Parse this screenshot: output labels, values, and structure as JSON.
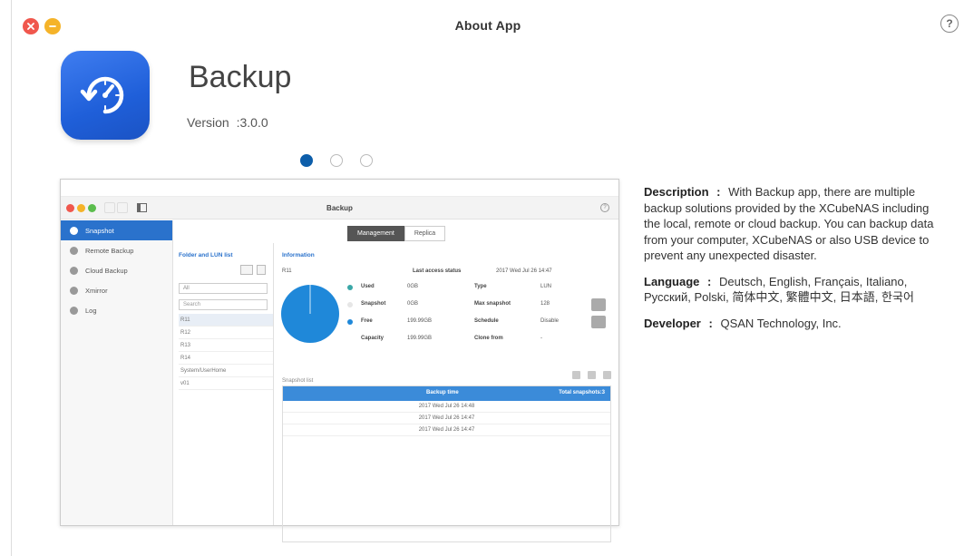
{
  "window": {
    "title": "About App",
    "help_symbol": "?"
  },
  "app": {
    "name": "Backup",
    "version_label": "Version",
    "version_sep": ":",
    "version": "3.0.0",
    "icon": "backup-restore-icon"
  },
  "pager": {
    "count": 3,
    "active_index": 0
  },
  "preview": {
    "title": "Backup",
    "sidebar": [
      {
        "label": "Snapshot",
        "active": true
      },
      {
        "label": "Remote Backup",
        "active": false
      },
      {
        "label": "Cloud Backup",
        "active": false
      },
      {
        "label": "Xmirror",
        "active": false
      },
      {
        "label": "Log",
        "active": false
      }
    ],
    "tabs": [
      {
        "label": "Management",
        "active": true
      },
      {
        "label": "Replica",
        "active": false
      }
    ],
    "lun_panel": {
      "header": "Folder and LUN list",
      "filter": "All",
      "search_placeholder": "Search",
      "items": [
        "R11",
        "R12",
        "R13",
        "R14",
        "System/UserHome",
        "v01"
      ]
    },
    "info": {
      "header": "Information",
      "name": "R11",
      "last_access_label": "Last access status",
      "last_access_value": "2017 Wed Jul 26 14:47",
      "rows": [
        {
          "label": "Used",
          "value": "0GB",
          "key": "Type",
          "kvalue": "LUN"
        },
        {
          "label": "Snapshot",
          "value": "0GB",
          "key": "Max snapshot",
          "kvalue": "128"
        },
        {
          "label": "Free",
          "value": "199.99GB",
          "key": "Schedule",
          "kvalue": "Disable"
        },
        {
          "label": "Capacity",
          "value": "199.99GB",
          "key": "Clone from",
          "kvalue": "-"
        }
      ],
      "chart_colors": {
        "used": "#3aa7a7",
        "snapshot": "#e6e6e6",
        "free": "#1f88d9"
      }
    },
    "snapshots": {
      "label": "Snapshot list",
      "col_time": "Backup time",
      "col_total": "Total snapshots:3",
      "rows": [
        "2017 Wed Jul 26 14:48",
        "2017 Wed Jul 26 14:47",
        "2017 Wed Jul 26 14:47"
      ]
    }
  },
  "details": {
    "description_label": "Description",
    "description": "With Backup app, there are multiple backup solutions provided by the XCubeNAS including the local, remote or cloud backup. You can backup data from your computer, XCubeNAS or also USB device to prevent any unexpected disaster.",
    "language_label": "Language",
    "language": "Deutsch, English, Français, Italiano, Русский, Polski, 简体中文, 繁體中文, 日本語, 한국어",
    "developer_label": "Developer",
    "developer": "QSAN Technology, Inc.",
    "separator": ":"
  }
}
